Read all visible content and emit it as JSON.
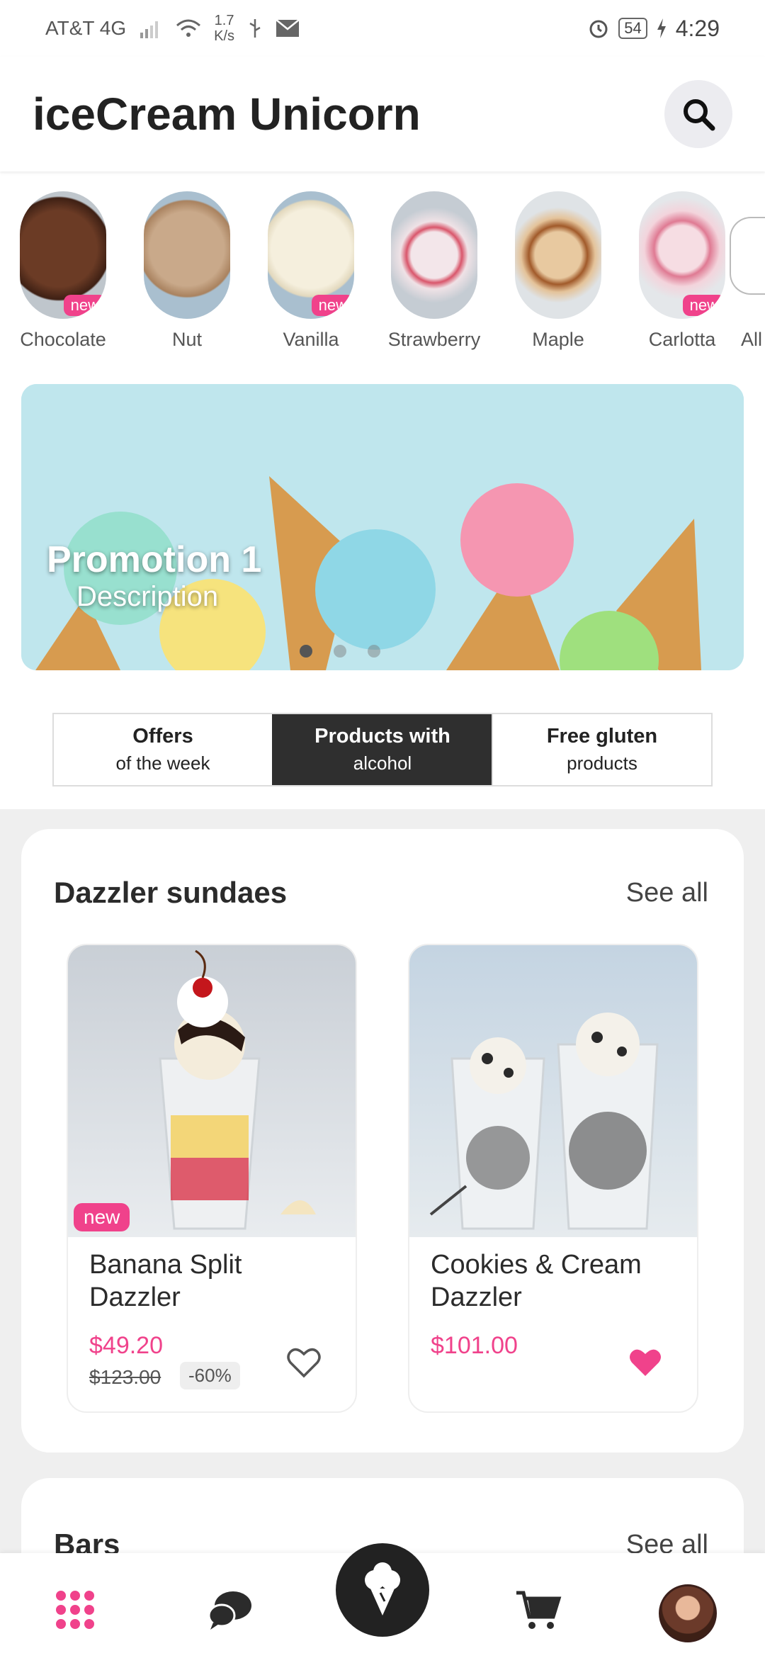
{
  "status_bar": {
    "carrier": "AT&T 4G",
    "speed_value": "1.7",
    "speed_unit": "K/s",
    "battery": "54",
    "time": "4:29"
  },
  "header": {
    "title": "iceCream Unicorn",
    "search_icon": "search-icon"
  },
  "flavors": [
    {
      "label": "Chocolate",
      "badge": "new",
      "color": "#5a3322"
    },
    {
      "label": "Nut",
      "badge": "",
      "color": "#b89b7c"
    },
    {
      "label": "Vanilla",
      "badge": "new",
      "color": "#efe6cf"
    },
    {
      "label": "Strawberry",
      "badge": "",
      "color": "#e7d7dc"
    },
    {
      "label": "Maple",
      "badge": "",
      "color": "#c89a6a"
    },
    {
      "label": "Carlotta",
      "badge": "new",
      "color": "#f1c8d2"
    },
    {
      "label": "All",
      "badge": "",
      "color": "#ffffff"
    }
  ],
  "banner": {
    "title": "Promotion 1",
    "description": "Description",
    "active_slide": 1,
    "slides": 3
  },
  "tabs": [
    {
      "title": "Offers",
      "subtitle": "of the week",
      "active": false
    },
    {
      "title": "Products with",
      "subtitle": "alcohol",
      "active": true
    },
    {
      "title": "Free gluten",
      "subtitle": "products",
      "active": false
    }
  ],
  "sections": [
    {
      "title": "Dazzler sundaes",
      "see_all": "See all",
      "products": [
        {
          "name": "Banana Split Dazzler",
          "price": "$49.20",
          "old_price": "$123.00",
          "discount": "-60%",
          "badge": "new",
          "favorite": false
        },
        {
          "name": "Cookies & Cream Dazzler",
          "price": "$101.00",
          "old_price": "",
          "discount": "",
          "badge": "",
          "favorite": true
        }
      ]
    },
    {
      "title": "Bars",
      "see_all": "See all"
    }
  ],
  "bottom_nav": {
    "items": [
      "grid-menu-icon",
      "chat-icon",
      "ice-cream-icon",
      "cart-icon",
      "avatar"
    ]
  },
  "colors": {
    "accent": "#f0428b",
    "dark": "#2f2f2f"
  }
}
